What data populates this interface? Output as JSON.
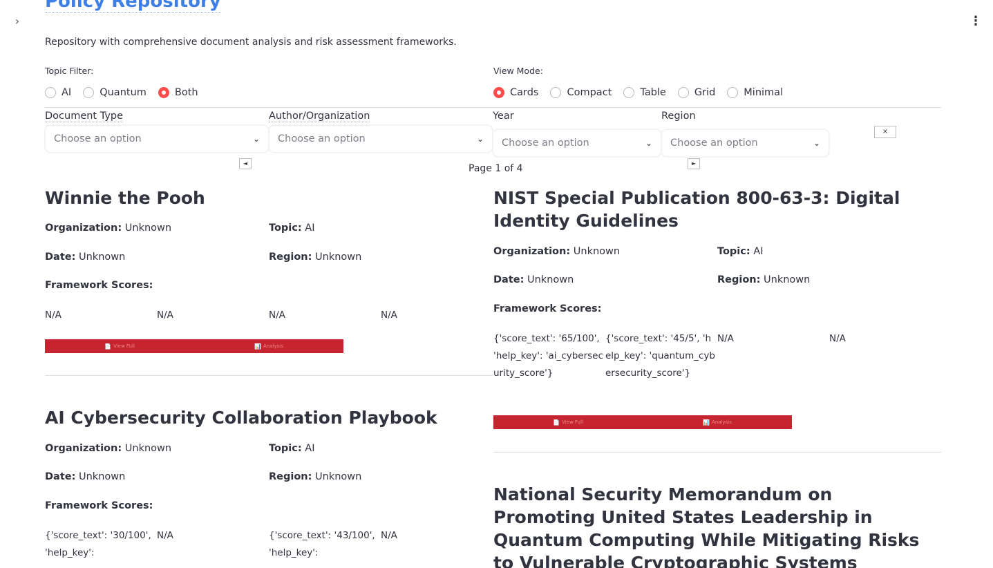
{
  "app": {
    "title": "Policy Repository",
    "description": "Repository with comprehensive document analysis and risk assessment frameworks.",
    "sidebar_toggle_icon": "chevron-right-icon",
    "menu_icon": "kebab-menu-icon"
  },
  "topic_filter": {
    "label": "Topic Filter:",
    "options": [
      "AI",
      "Quantum",
      "Both"
    ],
    "selected": "Both"
  },
  "view_mode": {
    "label": "View Mode:",
    "options": [
      "Cards",
      "Compact",
      "Table",
      "Grid",
      "Minimal"
    ],
    "selected": "Cards"
  },
  "filters": {
    "document_type": {
      "label": "Document Type",
      "placeholder": "Choose an option"
    },
    "author": {
      "label": "Author/Organization",
      "placeholder": "Choose an option"
    },
    "year": {
      "label": "Year",
      "placeholder": "Choose an option"
    },
    "region": {
      "label": "Region",
      "placeholder": "Choose an option"
    },
    "clear_label": "×"
  },
  "pagination": {
    "prev_label": "◄",
    "next_label": "►",
    "page_text": "Page 1 of 4"
  },
  "field_labels": {
    "organization": "Organization:",
    "topic": "Topic:",
    "date": "Date:",
    "region": "Region:",
    "framework_scores": "Framework Scores:"
  },
  "actions": {
    "view_full": "View Full",
    "analysis": "Analysis",
    "view_icon": "📄",
    "analysis_icon": "📊"
  },
  "documents": [
    {
      "title": "Winnie the Pooh",
      "organization": "Unknown",
      "topic": "AI",
      "date": "Unknown",
      "region": "Unknown",
      "scores": [
        "N/A",
        "N/A",
        "N/A",
        "N/A"
      ]
    },
    {
      "title": "NIST Special Publication 800-63-3: Digital Identity Guidelines",
      "organization": "Unknown",
      "topic": "AI",
      "date": "Unknown",
      "region": "Unknown",
      "scores": [
        "{'score_text': '65/100', 'help_key': 'ai_cybersecurity_score'}",
        "{'score_text': '45/5', 'help_key': 'quantum_cybersecurity_score'}",
        "N/A",
        "N/A"
      ]
    },
    {
      "title": "AI Cybersecurity Collaboration Playbook",
      "organization": "Unknown",
      "topic": "AI",
      "date": "Unknown",
      "region": "Unknown",
      "scores": [
        "{'score_text': '30/100', 'help_key':",
        "N/A",
        "{'score_text': '43/100', 'help_key':",
        "N/A"
      ]
    },
    {
      "title": "National Security Memorandum on Promoting United States Leadership in Quantum Computing While Mitigating Risks to Vulnerable Cryptographic Systems"
    }
  ]
}
